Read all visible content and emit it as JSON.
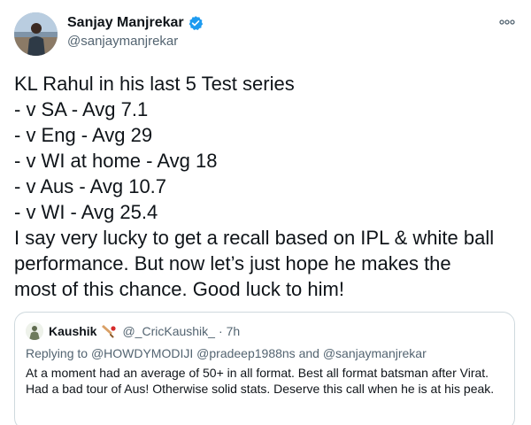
{
  "author": {
    "name": "Sanjay Manjrekar",
    "handle": "@sanjaymanjrekar"
  },
  "tweet": {
    "lines": [
      "KL Rahul in his last 5 Test series",
      "- v SA - Avg 7.1",
      "- v Eng - Avg 29",
      "- v WI at home - Avg 18",
      "- v Aus - Avg 10.7",
      "- v WI - Avg 25.4",
      "I say very lucky to get a recall based on IPL & white ball",
      "performance. But now let’s just hope he makes the",
      "most of this chance. Good luck to him!"
    ]
  },
  "quote": {
    "name": "Kaushik",
    "handle": "@_CricKaushik_",
    "dot": "·",
    "time": "7h",
    "replying_prefix": "Replying to",
    "mention_1": "@HOWDYMODIJI",
    "mention_2": "@pradeep1988ns",
    "and_word": "and",
    "mention_3": "@sanjaymanjrekar",
    "body": "At a moment had an average of 50+ in all format. Best all format batsman after Virat. Had a bad tour of Aus! Otherwise solid stats. Deserve this call when he is at his peak."
  },
  "icons": {
    "verified": "verified-badge-icon",
    "more": "more-options-icon",
    "emoji": "cricket-bat-emoji"
  },
  "colors": {
    "verified_blue": "#1d9bf0",
    "secondary_text": "#536471",
    "border": "#cfd9de"
  }
}
